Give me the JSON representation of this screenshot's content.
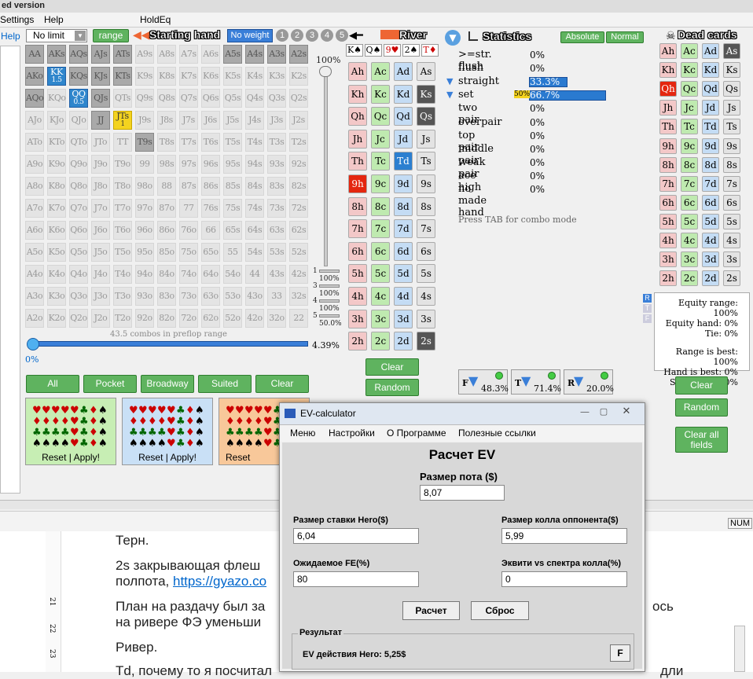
{
  "window": {
    "title": "ed version",
    "menus": [
      "Settings",
      "Help",
      "HoldEq"
    ]
  },
  "toolbar": {
    "help": "Help",
    "limit": "No limit",
    "range_btn": "range",
    "starting_hand": "Starting hand",
    "no_weight": "No weight",
    "weights": [
      "1",
      "2",
      "3",
      "4",
      "5"
    ],
    "river": "River",
    "statistics": "Statistics",
    "absolute": "Absolute",
    "normal": "Normal",
    "dead_cards": "Dead cards"
  },
  "grid": {
    "rows": [
      [
        "AA",
        "AKs",
        "AQs",
        "AJs",
        "ATs",
        "A9s",
        "A8s",
        "A7s",
        "A6s",
        "A5s",
        "A4s",
        "A3s",
        "A2s"
      ],
      [
        "AKo",
        "KK",
        "KQs",
        "KJs",
        "KTs",
        "K9s",
        "K8s",
        "K7s",
        "K6s",
        "K5s",
        "K4s",
        "K3s",
        "K2s"
      ],
      [
        "AQo",
        "KQo",
        "QQ",
        "QJs",
        "QTs",
        "Q9s",
        "Q8s",
        "Q7s",
        "Q6s",
        "Q5s",
        "Q4s",
        "Q3s",
        "Q2s"
      ],
      [
        "AJo",
        "KJo",
        "QJo",
        "JJ",
        "JTs",
        "J9s",
        "J8s",
        "J7s",
        "J6s",
        "J5s",
        "J4s",
        "J3s",
        "J2s"
      ],
      [
        "ATo",
        "KTo",
        "QTo",
        "JTo",
        "TT",
        "T9s",
        "T8s",
        "T7s",
        "T6s",
        "T5s",
        "T4s",
        "T3s",
        "T2s"
      ],
      [
        "A9o",
        "K9o",
        "Q9o",
        "J9o",
        "T9o",
        "99",
        "98s",
        "97s",
        "96s",
        "95s",
        "94s",
        "93s",
        "92s"
      ],
      [
        "A8o",
        "K8o",
        "Q8o",
        "J8o",
        "T8o",
        "98o",
        "88",
        "87s",
        "86s",
        "85s",
        "84s",
        "83s",
        "82s"
      ],
      [
        "A7o",
        "K7o",
        "Q7o",
        "J7o",
        "T7o",
        "97o",
        "87o",
        "77",
        "76s",
        "75s",
        "74s",
        "73s",
        "72s"
      ],
      [
        "A6o",
        "K6o",
        "Q6o",
        "J6o",
        "T6o",
        "96o",
        "86o",
        "76o",
        "66",
        "65s",
        "64s",
        "63s",
        "62s"
      ],
      [
        "A5o",
        "K5o",
        "Q5o",
        "J5o",
        "T5o",
        "95o",
        "85o",
        "75o",
        "65o",
        "55",
        "54s",
        "53s",
        "52s"
      ],
      [
        "A4o",
        "K4o",
        "Q4o",
        "J4o",
        "T4o",
        "94o",
        "84o",
        "74o",
        "64o",
        "54o",
        "44",
        "43s",
        "42s"
      ],
      [
        "A3o",
        "K3o",
        "Q3o",
        "J3o",
        "T3o",
        "93o",
        "83o",
        "73o",
        "63o",
        "53o",
        "43o",
        "33",
        "32s"
      ],
      [
        "A2o",
        "K2o",
        "Q2o",
        "J2o",
        "T2o",
        "92o",
        "82o",
        "72o",
        "62o",
        "52o",
        "42o",
        "32o",
        "22"
      ]
    ],
    "kk_sub": "1.5",
    "qq_sub": "0.5",
    "jts_sub": "1",
    "combos_text": "43.5 combos in preflop range",
    "slider_left": "0%",
    "slider_right": "4.39%",
    "pct_top": "100%",
    "weight_rows": [
      {
        "n": "1",
        "v": "100%"
      },
      {
        "n": "3",
        "v": "100%"
      },
      {
        "n": "4",
        "v": "100%"
      },
      {
        "n": "5",
        "v": "50.0%"
      }
    ]
  },
  "range_buttons": [
    "All",
    "Pocket",
    "Broadway",
    "Suited",
    "Clear"
  ],
  "panels": {
    "reset": "Reset",
    "sep": "|",
    "apply": "Apply!"
  },
  "board": {
    "top": [
      "K♠",
      "Q♠",
      "9♥",
      "2♠",
      "T♦"
    ],
    "clear": "Clear",
    "random": "Random",
    "columns": [
      [
        "Ah",
        "Kh",
        "Qh",
        "Jh",
        "Th",
        "9h",
        "8h",
        "7h",
        "6h",
        "5h",
        "4h",
        "3h",
        "2h"
      ],
      [
        "Ac",
        "Kc",
        "Qc",
        "Jc",
        "Tc",
        "9c",
        "8c",
        "7c",
        "6c",
        "5c",
        "4c",
        "3c",
        "2c"
      ],
      [
        "Ad",
        "Kd",
        "Qd",
        "Jd",
        "Td",
        "9d",
        "8d",
        "7d",
        "6d",
        "5d",
        "4d",
        "3d",
        "2d"
      ],
      [
        "As",
        "Ks",
        "Qs",
        "Js",
        "Ts",
        "9s",
        "8s",
        "7s",
        "6s",
        "5s",
        "4s",
        "3s",
        "2s"
      ]
    ]
  },
  "stats": {
    "rows": [
      {
        "name": ">=str. flush",
        "value": "0%",
        "frac": 0
      },
      {
        "name": "flush",
        "value": "0%",
        "frac": 0
      },
      {
        "name": "straight",
        "value": "33.3%",
        "frac": 0.333
      },
      {
        "name": "set",
        "value": "66.7%",
        "frac": 0.667
      },
      {
        "name": "two pair",
        "value": "0%",
        "frac": 0
      },
      {
        "name": "overpair",
        "value": "0%",
        "frac": 0
      },
      {
        "name": "top pair",
        "value": "0%",
        "frac": 0
      },
      {
        "name": "middle pair",
        "value": "0%",
        "frac": 0
      },
      {
        "name": "weak pair",
        "value": "0%",
        "frac": 0
      },
      {
        "name": "ace high",
        "value": "0%",
        "frac": 0
      },
      {
        "name": "no made hand",
        "value": "0%",
        "frac": 0
      }
    ],
    "set_marker": "50%",
    "tab_hint": "Press TAB for combo mode",
    "filters": [
      {
        "l": "F",
        "v": "48.3%"
      },
      {
        "l": "T",
        "v": "71.4%"
      },
      {
        "l": "R",
        "v": "20.0%"
      }
    ]
  },
  "equity": {
    "range": "Equity range: 100%",
    "hand": "Equity hand: 0%",
    "tie": "Tie: 0%",
    "range_best": "Range is best: 100%",
    "hand_best": "Hand is best: 0%",
    "same": "Same hand: 0%",
    "tags": [
      "R",
      "T",
      "F"
    ]
  },
  "dead": {
    "clear": "Clear",
    "random": "Random",
    "clear_all": "Clear all fields"
  },
  "ev": {
    "title": "EV-calculator",
    "menu": [
      "Меню",
      "Настройки",
      "О Программе",
      "Полезные ссылки"
    ],
    "heading": "Расчет EV",
    "pot_label": "Размер пота ($)",
    "pot": "8,07",
    "bet_label": "Размер ставки Hero($)",
    "bet": "6,04",
    "call_label": "Размер колла оппонента($)",
    "call": "5,99",
    "fe_label": "Ожидаемое FE(%)",
    "fe": "80",
    "eq_label": "Эквити vs спектра колла(%)",
    "eq": "0",
    "calc": "Расчет",
    "reset": "Сброс",
    "result_label": "Результат",
    "result": "EV  действия Hero: 5,25$",
    "f_btn": "F"
  },
  "doc": {
    "l1": "Терн.",
    "l2": "2s закрывающая флеш",
    "l3": "полпота, ",
    "link": "https://gyazo.co",
    "l4": "План на раздачу был за",
    "l4b": "ось",
    "l5": "на ривере ФЭ уменьши",
    "l6": "Ривер.",
    "l7": "Td, почему то я посчитал",
    "l7b": "дли",
    "ruler": [
      "21",
      "22",
      "23"
    ],
    "num": "NUM"
  }
}
